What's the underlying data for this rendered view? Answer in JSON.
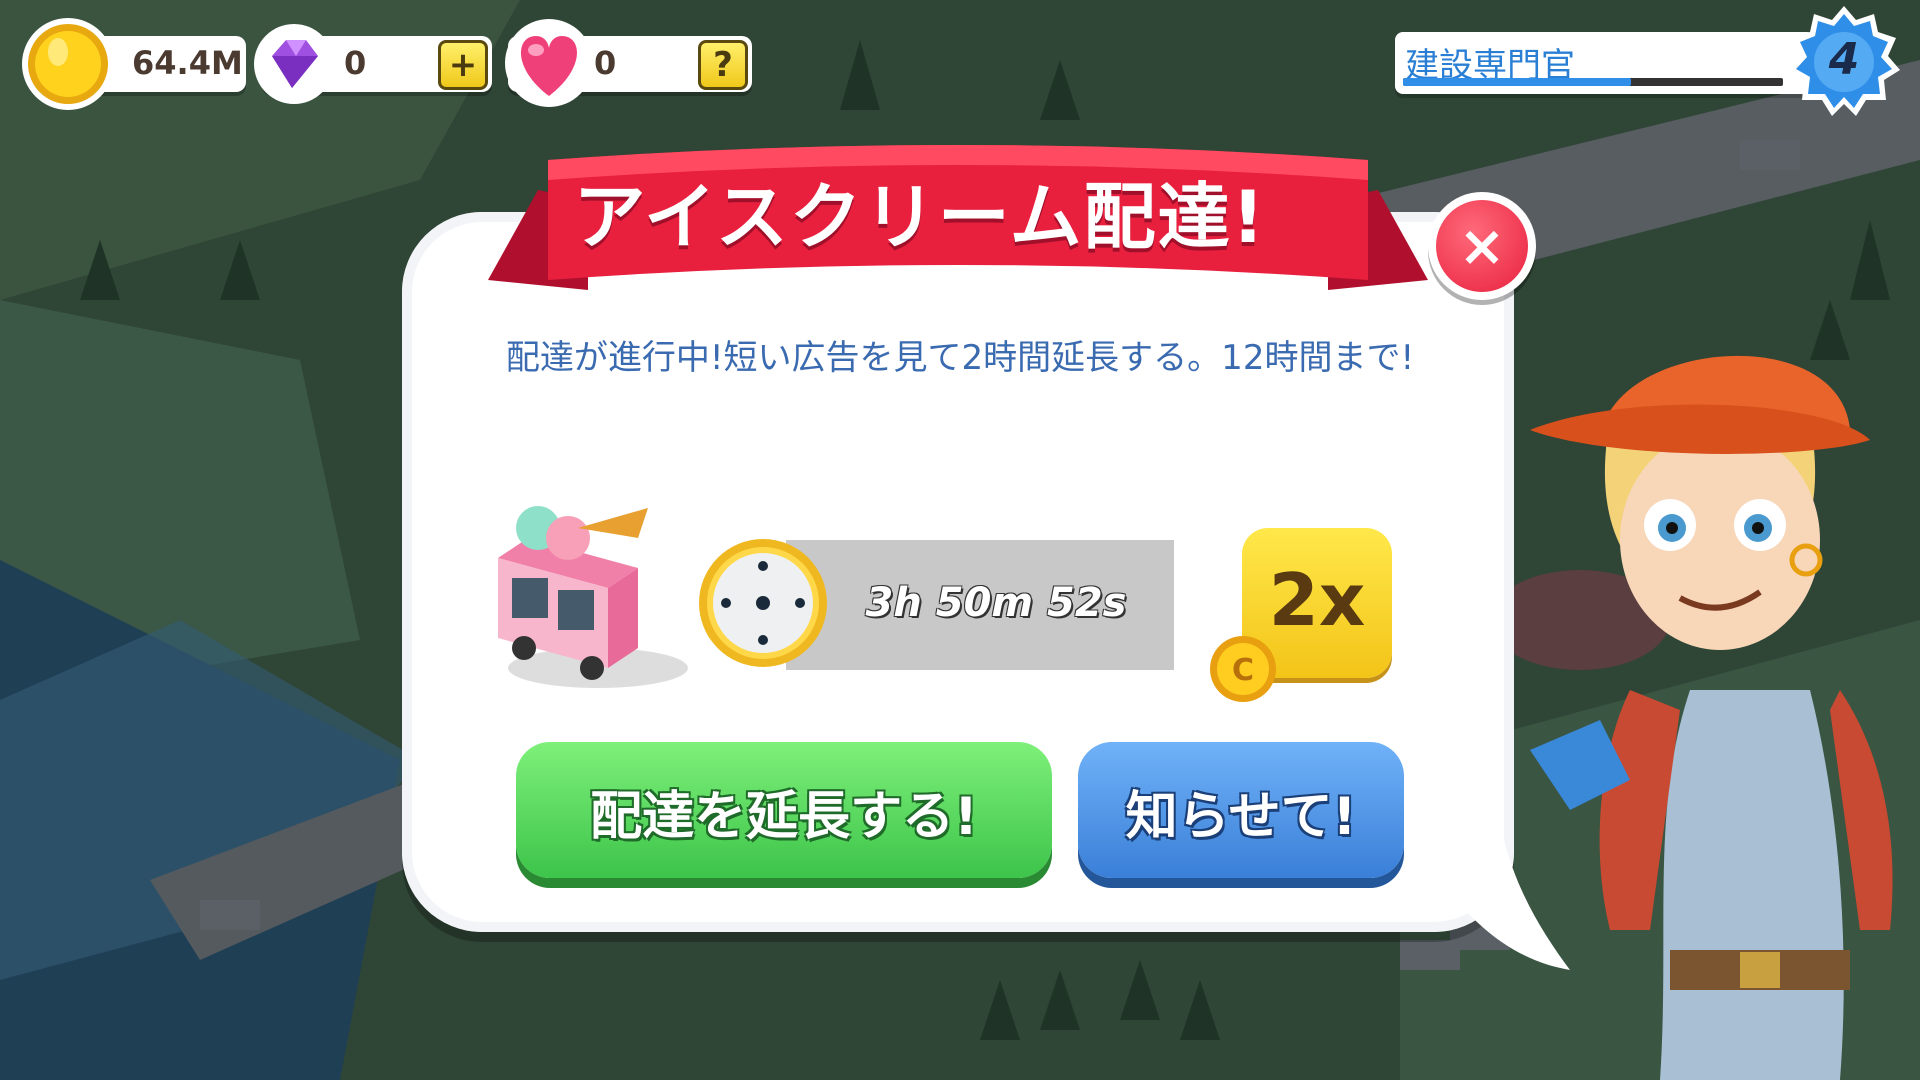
{
  "hud": {
    "coins": "64.4M",
    "gems": "0",
    "hearts": "0",
    "add_button": "+",
    "help_button": "?"
  },
  "level": {
    "title": "建設専門官",
    "number": "4",
    "progress": 0.6
  },
  "dialog": {
    "title": "アイスクリーム配達!",
    "close": "×",
    "message": "配達が進行中!短い広告を見て2時間延長する。12時間まで!",
    "timer": "3h 50m 52s",
    "bonus": "2x",
    "bonus_coin": "C",
    "extend_button": "配達を延長する!",
    "notify_button": "知らせて!"
  },
  "colors": {
    "ribbon": "#e8203e",
    "accent_blue": "#3a6ab0",
    "green_button": "#3dc44a",
    "blue_button": "#3a7fd8",
    "gold": "#f3c418"
  },
  "icons": [
    "coin-icon",
    "gem-icon",
    "heart-icon",
    "plus-icon",
    "help-icon",
    "level-badge-icon",
    "close-icon",
    "clock-icon",
    "ice-cream-truck-icon",
    "coin-small-icon"
  ]
}
